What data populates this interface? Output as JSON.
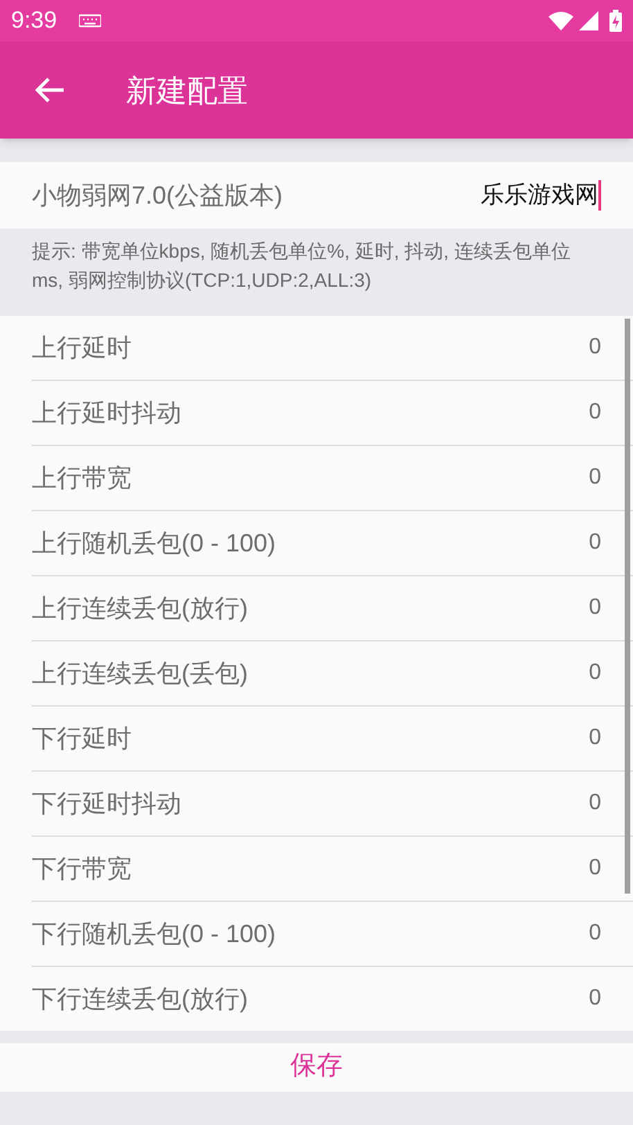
{
  "status_bar": {
    "time": "9:39"
  },
  "app_bar": {
    "title": "新建配置"
  },
  "name_field": {
    "label": "小物弱网7.0(公益版本)",
    "value": "乐乐游戏网"
  },
  "hint": "提示: 带宽单位kbps, 随机丢包单位%, 延时, 抖动, 连续丢包单位ms, 弱网控制协议(TCP:1,UDP:2,ALL:3)",
  "settings": [
    {
      "label": "上行延时",
      "value": "0"
    },
    {
      "label": "上行延时抖动",
      "value": "0"
    },
    {
      "label": "上行带宽",
      "value": "0"
    },
    {
      "label": "上行随机丢包(0 - 100)",
      "value": "0"
    },
    {
      "label": "上行连续丢包(放行)",
      "value": "0"
    },
    {
      "label": "上行连续丢包(丢包)",
      "value": "0"
    },
    {
      "label": "下行延时",
      "value": "0"
    },
    {
      "label": "下行延时抖动",
      "value": "0"
    },
    {
      "label": "下行带宽",
      "value": "0"
    },
    {
      "label": "下行随机丢包(0 - 100)",
      "value": "0"
    },
    {
      "label": "下行连续丢包(放行)",
      "value": "0"
    }
  ],
  "save_button": "保存"
}
